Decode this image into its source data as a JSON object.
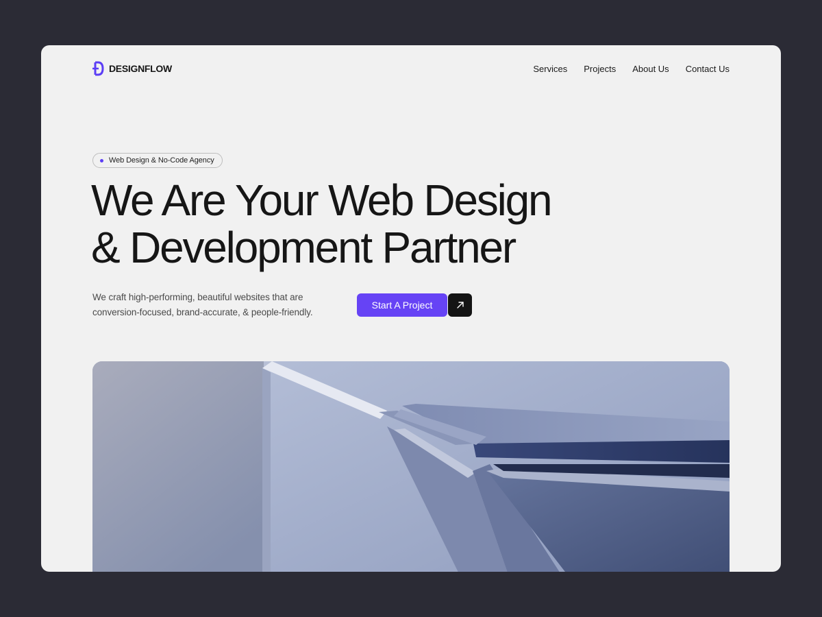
{
  "brand": {
    "name": "DESIGNFLOW",
    "logo_icon": "designflow-d-logo",
    "accent_color": "#6643f5"
  },
  "nav": {
    "items": [
      {
        "label": "Services"
      },
      {
        "label": "Projects"
      },
      {
        "label": "About Us"
      },
      {
        "label": "Contact Us"
      }
    ]
  },
  "hero": {
    "badge": "Web Design & No-Code Agency",
    "headline_line1": "We Are Your Web Design",
    "headline_line2": "& Development Partner",
    "description_line1": "We craft high-performing, beautiful websites that are",
    "description_line2": "conversion-focused, brand-accurate, & people-friendly.",
    "cta_label": "Start A Project",
    "cta_icon": "arrow-up-right-icon",
    "image_icon": "abstract-3d-render"
  },
  "colors": {
    "page_background": "#2b2b35",
    "panel_background": "#f1f1f1",
    "text_primary": "#161616",
    "cta_button": "#6643f5",
    "cta_arrow_button": "#141414"
  }
}
